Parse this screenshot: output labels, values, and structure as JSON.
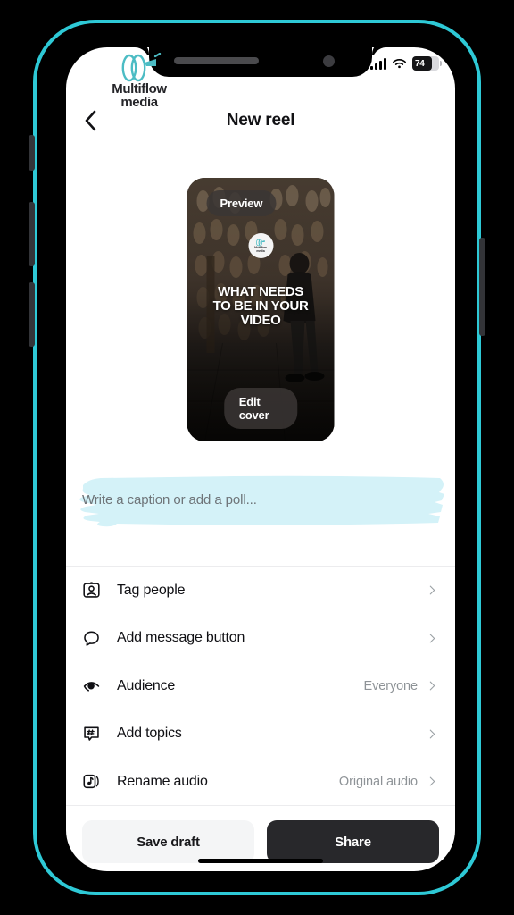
{
  "brand": {
    "name_line1": "Multiflow",
    "name_line2": "media",
    "mark": "multiflow-logo-mark",
    "color": "#4cbcc4"
  },
  "status_bar": {
    "cellular_icon": "cellular-bars-icon",
    "wifi_icon": "wifi-icon",
    "battery_level": "74",
    "battery_icon": "battery-icon"
  },
  "nav": {
    "back_icon": "chevron-left-icon",
    "title": "New reel"
  },
  "video": {
    "preview_label": "Preview",
    "edit_cover_label": "Edit cover",
    "overlay_text_line1": "WHAT NEEDS",
    "overlay_text_line2": "TO BE IN YOUR",
    "overlay_text_line3": "VIDEO",
    "badge_line1": "Multiflow",
    "badge_line2": "media"
  },
  "caption": {
    "placeholder": "Write a caption or add a poll...",
    "highlight_color": "#d4f2f8"
  },
  "list": {
    "items": [
      {
        "label": "Tag people",
        "value": "",
        "icon": "tag-people-icon",
        "chevron": "chevron-right-icon"
      },
      {
        "label": "Add message button",
        "value": "",
        "icon": "chat-bubble-icon",
        "chevron": "chevron-right-icon"
      },
      {
        "label": "Audience",
        "value": "Everyone",
        "icon": "audience-eye-icon",
        "chevron": "chevron-right-icon"
      },
      {
        "label": "Add topics",
        "value": "",
        "icon": "hashtag-icon",
        "chevron": "chevron-right-icon"
      },
      {
        "label": "Rename audio",
        "value": "Original audio",
        "icon": "music-note-icon",
        "chevron": "chevron-right-icon"
      }
    ]
  },
  "actions": {
    "save_draft_label": "Save draft",
    "share_label": "Share"
  },
  "device": {
    "frame_color": "#2ec9d6"
  }
}
